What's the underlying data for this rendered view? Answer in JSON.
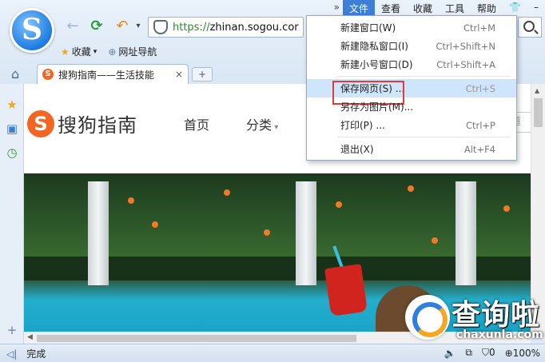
{
  "menubar": {
    "overflow": "»",
    "items": [
      "文件",
      "查看",
      "收藏",
      "工具",
      "帮助"
    ],
    "active_index": 0
  },
  "address": {
    "url_prefix": "https://",
    "url_host": "zhinan.sogou.cor"
  },
  "favorites": {
    "bookmarks_label": "收藏",
    "nav_label": "网址导航"
  },
  "tab": {
    "favicon": "S",
    "title": "搜狗指南——生活技能",
    "close": "×",
    "new_tab": "+"
  },
  "site": {
    "logo_mark": "S",
    "logo_text": "搜狗指南",
    "nav": [
      "首页",
      "分类"
    ],
    "search_fragment": "道"
  },
  "file_menu": {
    "items": [
      {
        "label": "新建窗口(W)",
        "shortcut": "Ctrl+M"
      },
      {
        "label": "新建隐私窗口(I)",
        "shortcut": "Ctrl+Shift+N"
      },
      {
        "label": "新建小号窗口(D)",
        "shortcut": "Ctrl+Shift+A"
      },
      {
        "label": "保存网页(S) ...",
        "shortcut": "Ctrl+S",
        "highlighted": true
      },
      {
        "label": "另存为图片(M)...",
        "shortcut": ""
      },
      {
        "label": "打印(P) ...",
        "shortcut": "Ctrl+P"
      },
      {
        "label": "退出(X)",
        "shortcut": "Alt+F4"
      }
    ]
  },
  "status": {
    "text": "完成",
    "count": "0",
    "zoom": "100%"
  },
  "watermark": {
    "cn": "查询啦",
    "en": "chaxunla.com"
  },
  "colors": {
    "accent": "#3c7ed8",
    "highlight": "#cfe5fb",
    "callout": "#e23b3b",
    "brand": "#f26522"
  }
}
